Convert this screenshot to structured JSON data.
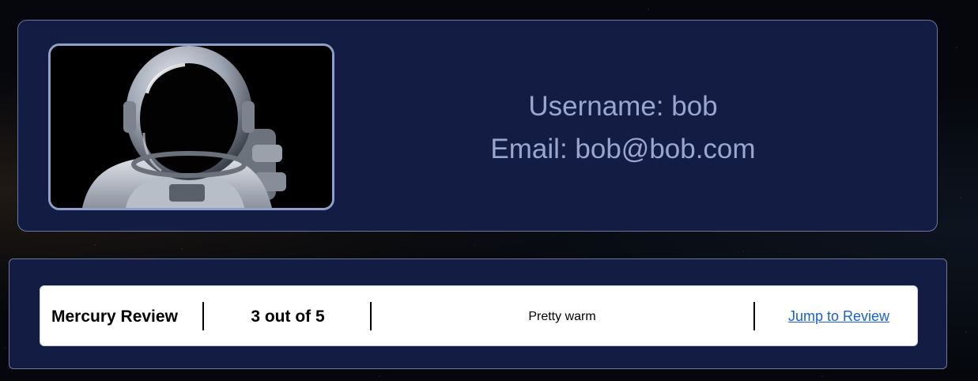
{
  "profile": {
    "username_text": "Username: bob",
    "email_text": "Email: bob@bob.com",
    "avatar_icon": "astronaut-avatar"
  },
  "reviews": [
    {
      "title": "Mercury Review",
      "rating_text": "3 out of 5",
      "body": "Pretty warm",
      "link_label": "Jump to Review"
    }
  ],
  "colors": {
    "panel_bg": "#131c43",
    "panel_border": "#6c7799",
    "profile_text": "#9aa6cf",
    "link": "#1b5fd6"
  }
}
